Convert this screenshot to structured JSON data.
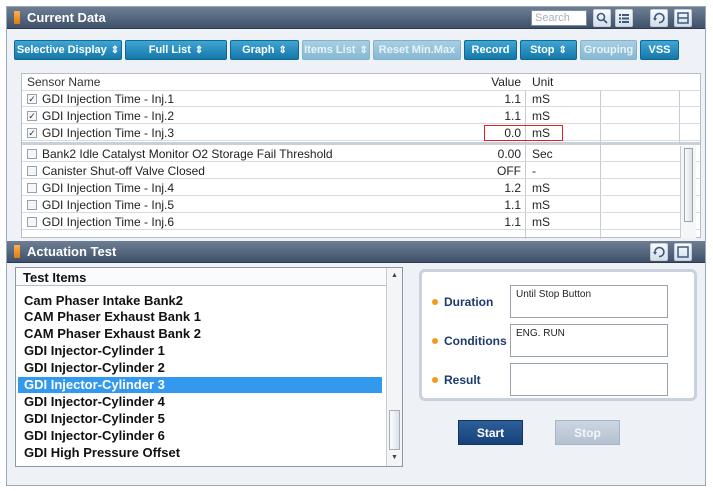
{
  "current_data": {
    "title": "Current Data",
    "search_placeholder": "Search",
    "icons": [
      "zoom-icon",
      "list-view-icon",
      "retry-icon",
      "panel-icon"
    ]
  },
  "toolbar": {
    "buttons": [
      {
        "label": "Selective Display",
        "spinner": "⇕",
        "enabled": true
      },
      {
        "label": "Full List",
        "spinner": "⇕",
        "enabled": true
      },
      {
        "label": "Graph",
        "spinner": "⇕",
        "enabled": true
      },
      {
        "label": "Items List",
        "spinner": "⇕",
        "enabled": false
      },
      {
        "label": "Reset Min.Max",
        "spinner": "",
        "enabled": false
      },
      {
        "label": "Record",
        "spinner": "",
        "enabled": true
      },
      {
        "label": "Stop",
        "spinner": "⇕",
        "enabled": true
      },
      {
        "label": "Grouping",
        "spinner": "",
        "enabled": false
      },
      {
        "label": "VSS",
        "spinner": "",
        "enabled": true
      }
    ]
  },
  "grid": {
    "headers": {
      "name": "Sensor Name",
      "value": "Value",
      "unit": "Unit"
    },
    "pinned_rows": [
      {
        "checked": true,
        "name": "GDI Injection Time - Inj.1",
        "value": "1.1",
        "unit": "mS",
        "highlight": false
      },
      {
        "checked": true,
        "name": "GDI Injection Time - Inj.2",
        "value": "1.1",
        "unit": "mS",
        "highlight": false
      },
      {
        "checked": true,
        "name": "GDI Injection Time - Inj.3",
        "value": "0.0",
        "unit": "mS",
        "highlight": true
      }
    ],
    "rows": [
      {
        "checked": false,
        "name": "Bank2 Idle Catalyst Monitor O2 Storage Fail Threshold",
        "value": "0.00",
        "unit": "Sec"
      },
      {
        "checked": false,
        "name": "Canister Shut-off Valve Closed",
        "value": "OFF",
        "unit": "-"
      },
      {
        "checked": false,
        "name": "GDI Injection Time - Inj.4",
        "value": "1.2",
        "unit": "mS"
      },
      {
        "checked": false,
        "name": "GDI Injection Time - Inj.5",
        "value": "1.1",
        "unit": "mS"
      },
      {
        "checked": false,
        "name": "GDI Injection Time - Inj.6",
        "value": "1.1",
        "unit": "mS"
      }
    ]
  },
  "actuation": {
    "title": "Actuation Test",
    "list_header": "Test Items",
    "items": [
      "Cam Phaser Intake Bank2",
      "CAM Phaser Exhaust Bank 1",
      "CAM Phaser Exhaust Bank 2",
      "GDI Injector-Cylinder 1",
      "GDI Injector-Cylinder 2",
      "GDI Injector-Cylinder 3",
      "GDI Injector-Cylinder 4",
      "GDI Injector-Cylinder 5",
      "GDI Injector-Cylinder 6",
      "GDI High Pressure Offset"
    ],
    "selected_index": 5,
    "duration_label": "Duration",
    "duration_value": "Until Stop Button",
    "conditions_label": "Conditions",
    "conditions_value": "ENG. RUN",
    "result_label": "Result",
    "result_value": "",
    "start_label": "Start",
    "stop_label": "Stop"
  },
  "colors": {
    "accent": "#1477a8",
    "title_bar": "#4c5d75",
    "selection": "#3399ee",
    "highlight_border": "#e02020",
    "start_button": "#17427a"
  }
}
